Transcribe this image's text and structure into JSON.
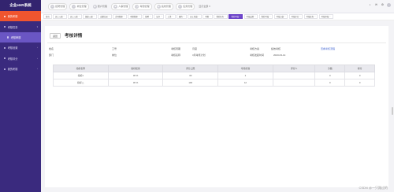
{
  "sidebar": {
    "logo": "企业eHR系统",
    "items": [
      {
        "label": "我的考核",
        "state": "active",
        "level": 1
      },
      {
        "label": "考核任务",
        "state": "open",
        "level": 1
      },
      {
        "label": "考核审核",
        "state": "selected",
        "level": 2
      },
      {
        "label": "考核设置",
        "state": "normal",
        "level": 1
      },
      {
        "label": "考核评分",
        "state": "normal",
        "level": 1
      },
      {
        "label": "我的考核",
        "state": "normal",
        "level": 1
      }
    ]
  },
  "topbar": {
    "nav": [
      {
        "label": "招聘管理",
        "icon": "user-icon"
      },
      {
        "label": "岗位管理",
        "icon": "briefcase-icon"
      },
      {
        "label": "账户管理",
        "icon": "account-icon"
      },
      {
        "label": "人事管理",
        "icon": "people-icon"
      },
      {
        "label": "考勤管理",
        "icon": "clock-icon"
      },
      {
        "label": "绩效管理",
        "icon": "chart-icon"
      },
      {
        "label": "任务管理",
        "icon": "task-icon"
      },
      {
        "label": "显示全部",
        "icon": "chevron-down-icon"
      }
    ],
    "right_icons": [
      "notification-icon",
      "message-icon",
      "settings-icon",
      "user-avatar-icon"
    ]
  },
  "tabs": [
    {
      "label": "首页",
      "active": false
    },
    {
      "label": "员工入职",
      "active": false
    },
    {
      "label": "员工入职",
      "active": false
    },
    {
      "label": "组织入职",
      "active": false
    },
    {
      "label": "出勤记录",
      "active": false
    },
    {
      "label": "合同管理",
      "active": false
    },
    {
      "label": "考勤管理",
      "active": false
    },
    {
      "label": "招聘",
      "active": false
    },
    {
      "label": "证书",
      "active": false
    },
    {
      "label": "工资",
      "active": false
    },
    {
      "label": "福利",
      "active": false
    },
    {
      "label": "员工档案",
      "active": false
    },
    {
      "label": "考勤",
      "active": false
    },
    {
      "label": "我的任务",
      "active": false
    },
    {
      "label": "我的考核",
      "active": true
    },
    {
      "label": "考核设置",
      "active": false
    },
    {
      "label": "我的考核",
      "active": false
    },
    {
      "label": "考核方案",
      "active": false
    },
    {
      "label": "考核评分",
      "active": false
    },
    {
      "label": "考核任务",
      "active": false
    },
    {
      "label": "考核审核",
      "active": false
    }
  ],
  "page": {
    "back_label": "返回",
    "title": "考核详情",
    "info": [
      [
        {
          "label": "姓名",
          "value": ""
        },
        {
          "label": "工号",
          "value": ""
        },
        {
          "label": "考核周期",
          "value": "月度"
        },
        {
          "label": "考核方案",
          "value": "绩效考核"
        },
        {
          "label": "",
          "value": "查看考核流程"
        }
      ],
      [
        {
          "label": "部门",
          "value": ""
        },
        {
          "label": "岗位",
          "value": ""
        },
        {
          "label": "考核名称",
          "value": "3月考核计划"
        },
        {
          "label": "考核发起时间",
          "value": "2023-03-14"
        },
        {
          "label": "",
          "value": ""
        }
      ]
    ],
    "table": {
      "headers": [
        "指标名称",
        "指标权重",
        "评分上限",
        "考核标准",
        "评分人",
        "分数",
        "得分"
      ],
      "rows": [
        [
          "指标1",
          "30 %",
          "30",
          "1",
          "",
          "0",
          "0"
        ],
        [
          "指标二",
          "30 %",
          "100",
          "12",
          "",
          "0",
          "0"
        ]
      ]
    }
  },
  "watermark": "CSDN @一只路过的",
  "colors": {
    "sidebar_bg": "#3a2a7e",
    "active_menu": "#f0552f",
    "active_tab": "#6c43c9",
    "link": "#4a6cd4"
  }
}
